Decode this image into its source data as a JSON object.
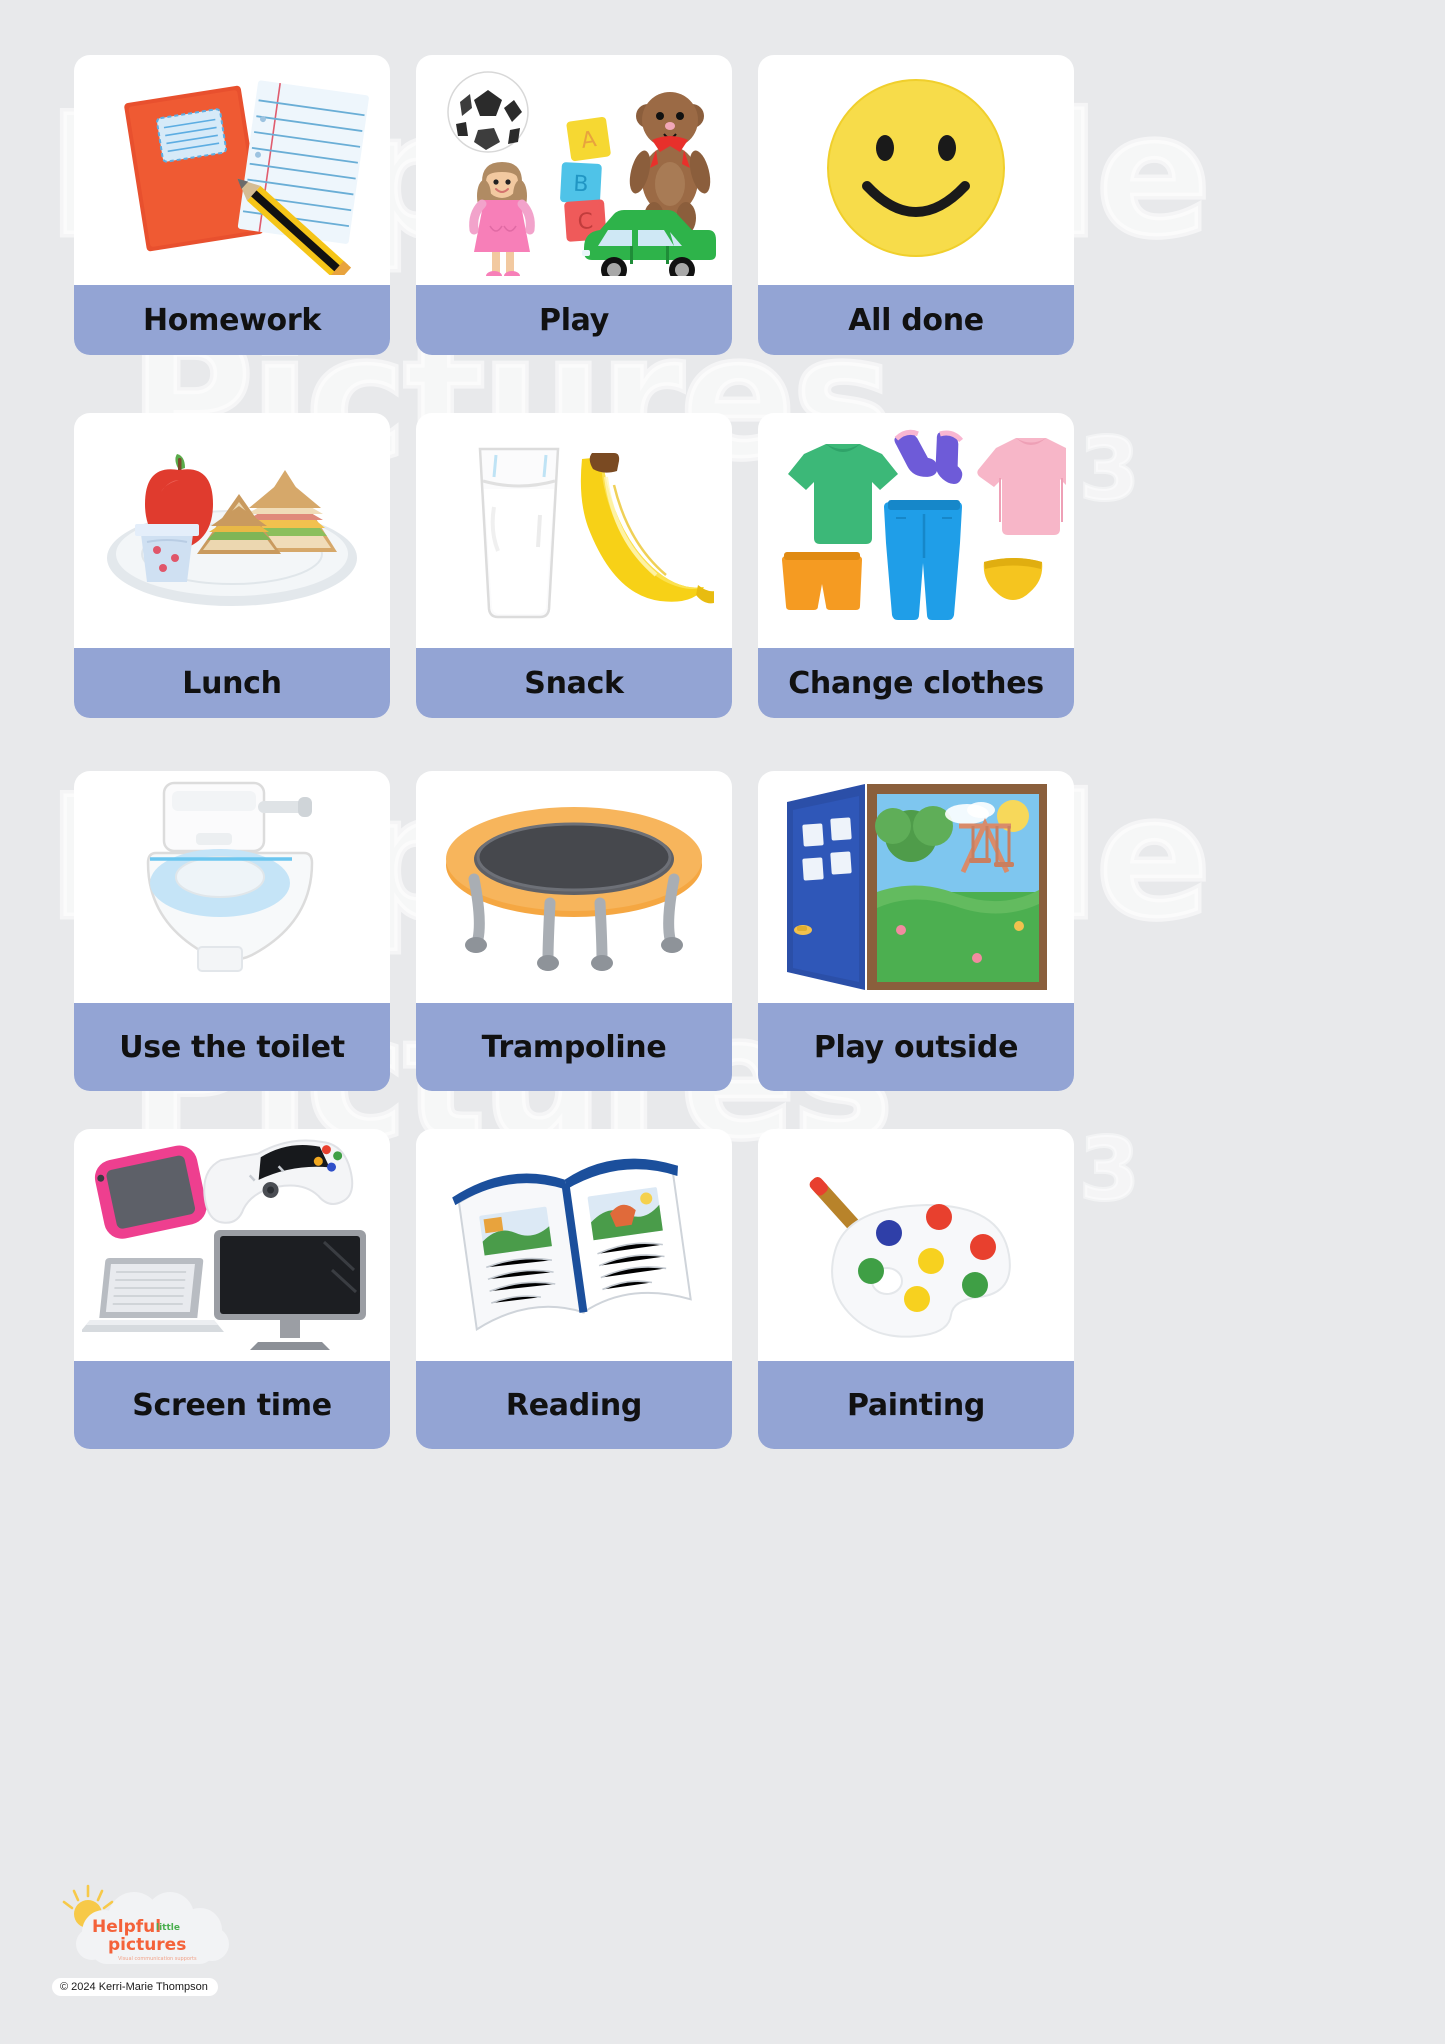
{
  "page": {
    "background_color": "#e8e9eb",
    "card_background": "#ffffff",
    "label_band_color": "#93a4d4",
    "label_text_color": "#111111"
  },
  "watermark": {
    "line1": "Helpful",
    "line2": "little",
    "line3": "Pictures",
    "year": "2023",
    "lines": [
      "Helpful little",
      "Pictures",
      "Helpful little",
      "Pictures"
    ]
  },
  "cards": [
    {
      "label": "Homework",
      "icon": "homework-icon"
    },
    {
      "label": "Play",
      "icon": "play-toys-icon"
    },
    {
      "label": "All done",
      "icon": "smiley-face-icon"
    },
    {
      "label": "Lunch",
      "icon": "lunch-plate-icon"
    },
    {
      "label": "Snack",
      "icon": "snack-milk-banana-icon"
    },
    {
      "label": "Change clothes",
      "icon": "clothes-icon"
    },
    {
      "label": "Use the toilet",
      "icon": "toilet-icon"
    },
    {
      "label": "Trampoline",
      "icon": "trampoline-icon"
    },
    {
      "label": "Play outside",
      "icon": "door-outside-icon"
    },
    {
      "label": "Screen time",
      "icon": "screens-icon"
    },
    {
      "label": "Reading",
      "icon": "open-book-icon"
    },
    {
      "label": "Painting",
      "icon": "paint-palette-icon"
    }
  ],
  "logo": {
    "word1": "Helpful",
    "word2": "little",
    "word3": "pictures",
    "tagline": "Visual communication supports",
    "copyright": "© 2024 Kerri-Marie Thompson",
    "color_orange": "#f4623a",
    "color_green": "#4caf50"
  }
}
